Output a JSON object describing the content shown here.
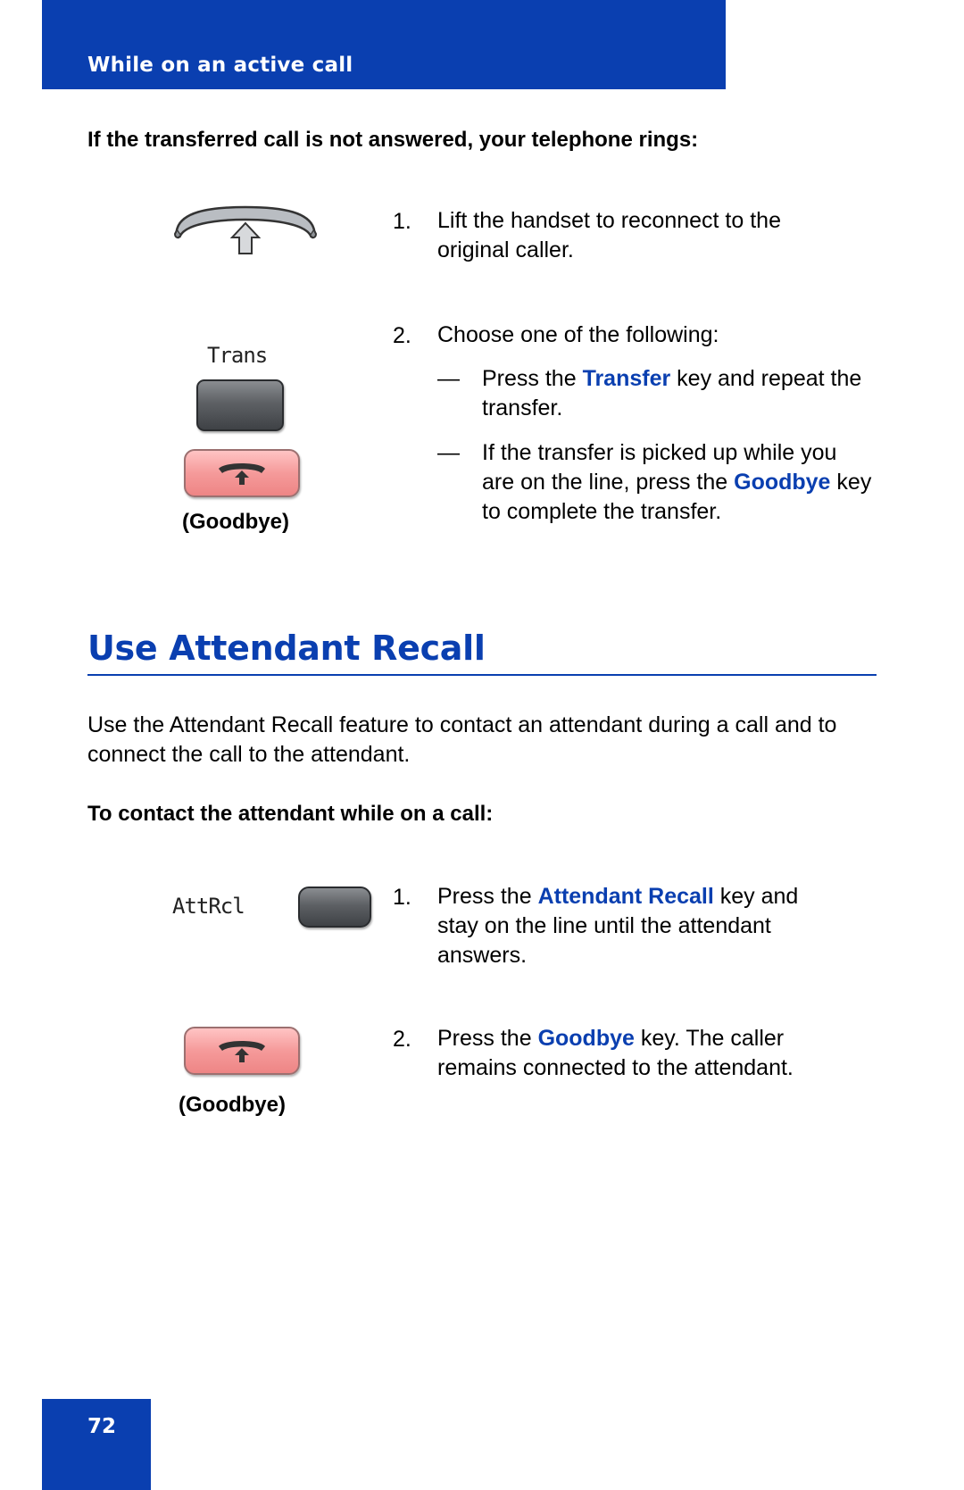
{
  "header": {
    "title": "While on an active call"
  },
  "section1": {
    "intro": "If the transferred call is not answered, your telephone rings:",
    "steps": [
      {
        "num": "1.",
        "text": "Lift the handset to reconnect to the original caller."
      },
      {
        "num": "2.",
        "text": "Choose one of the following:"
      }
    ],
    "options": [
      {
        "dash": "—",
        "pre": "Press the ",
        "key": "Transfer",
        "post": " key and repeat the transfer."
      },
      {
        "dash": "—",
        "pre": "If the transfer is picked up while you are on the line, press the ",
        "key": "Goodbye",
        "post": " key to complete the transfer."
      }
    ],
    "icons": {
      "handset": "handset-lift-icon",
      "trans_label": "Trans",
      "goodbye_caption": "(Goodbye)"
    }
  },
  "section2": {
    "title": "Use Attendant Recall",
    "description": "Use the Attendant Recall feature to contact an attendant during a call and to connect the call to the attendant.",
    "intro": "To contact the attendant while on a call:",
    "steps": [
      {
        "num": "1.",
        "pre": "Press the ",
        "key": "Attendant Recall",
        "post": " key and stay on the line until the attendant answers."
      },
      {
        "num": "2.",
        "pre": "Press the ",
        "key": "Goodbye",
        "post": " key. The caller remains connected to the attendant."
      }
    ],
    "icons": {
      "attrcl_label": "AttRcl",
      "goodbye_caption": "(Goodbye)"
    }
  },
  "footer": {
    "page_number": "72"
  },
  "colors": {
    "brand_blue": "#0a3fb0",
    "goodbye_red": "#f59a9a"
  }
}
